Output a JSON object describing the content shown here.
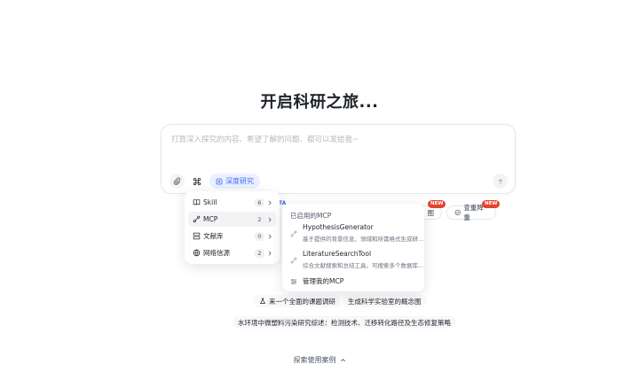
{
  "hero": {
    "title": "开启科研之旅..."
  },
  "composer": {
    "placeholder": "打算深入探究的内容、希望了解的问题、都可以发给我~",
    "deep_research_label": "深度研究"
  },
  "quick_chips": {
    "beta_label": "TA",
    "chip2_label": "图",
    "chip3_label": "查重降重",
    "new_badge": "NEW"
  },
  "menu": {
    "items": [
      {
        "label": "Skill",
        "count": "6",
        "icon": "book-icon"
      },
      {
        "label": "MCP",
        "count": "2",
        "icon": "plug-icon"
      },
      {
        "label": "文献库",
        "count": "0",
        "icon": "database-icon"
      },
      {
        "label": "网络信源",
        "count": "2",
        "icon": "globe-icon"
      }
    ]
  },
  "mcp_panel": {
    "header": "已启用的MCP",
    "items": [
      {
        "name": "HypothesisGenerator",
        "desc": "基于提供的背景信息、领域和所需格式生成研..."
      },
      {
        "name": "LiteratureSearchTool",
        "desc": "综合文献搜索和总结工具，可搜索多个数据库..."
      }
    ],
    "manage_label": "管理我的MCP"
  },
  "suggestions": {
    "s1": "来一个全面的课题调研",
    "s2": "生成科学实验室的概念图",
    "s3": "水环境中微塑料污染研究综述：检测技术、迁移转化路径及生态修复策略"
  },
  "footer": {
    "explore_label": "探索使用案例"
  },
  "colors": {
    "accent": "#3d6bf2",
    "new_badge": "#e4432f"
  }
}
